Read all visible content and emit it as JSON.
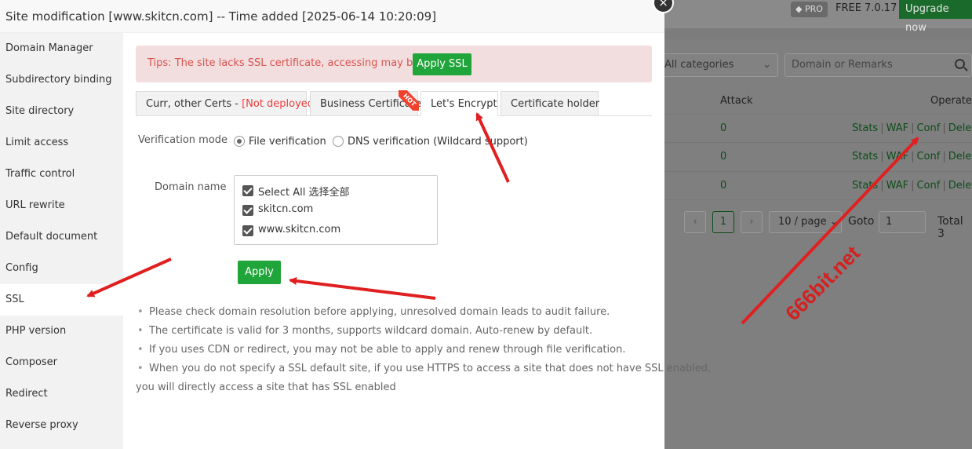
{
  "header_right": {
    "pro": "PRO",
    "free": "FREE",
    "version": "7.0.17",
    "upgrade": "Upgrade now"
  },
  "filters": {
    "category": "All categories",
    "search_placeholder": "Domain or Remarks"
  },
  "table": {
    "headers": {
      "attack": "Attack",
      "operate": "Operate"
    },
    "rows": [
      {
        "attack": "0",
        "actions": [
          "Stats",
          "WAF",
          "Conf",
          "Delete"
        ]
      },
      {
        "attack": "0",
        "actions": [
          "Stats",
          "WAF",
          "Conf",
          "Delete"
        ]
      },
      {
        "attack": "0",
        "actions": [
          "Stats",
          "WAF",
          "Conf",
          "Delete"
        ]
      }
    ]
  },
  "pagination": {
    "current_page": "1",
    "page_size": "10 / page",
    "goto_label": "Goto",
    "goto_value": "1",
    "total": "Total 3"
  },
  "modal": {
    "title": "Site modification [www.skitcn.com] -- Time added [2025-06-14 10:20:09]",
    "close": "×",
    "sidebar": [
      "Domain Manager",
      "Subdirectory binding",
      "Site directory",
      "Limit access",
      "Traffic control",
      "URL rewrite",
      "Default document",
      "Config",
      "SSL",
      "PHP version",
      "Composer",
      "Redirect",
      "Reverse proxy"
    ],
    "active_item": "SSL",
    "tips": {
      "text": "Tips: The site lacks SSL certificate, accessing may be risky.",
      "button": "Apply SSL"
    },
    "tabs": {
      "current_prefix": "Curr, other Certs - ",
      "current_status": "[Not deployed]",
      "business": "Business Certificate",
      "hot": "HOT",
      "letsencrypt": "Let's Encrypt",
      "holder": "Certificate holder"
    },
    "verification": {
      "label": "Verification mode",
      "file": "File verification",
      "dns": "DNS verification (Wildcard support)"
    },
    "domain_name": {
      "label": "Domain name",
      "select_all": "Select All  选择全部",
      "items": [
        "skitcn.com",
        "www.skitcn.com"
      ]
    },
    "apply_button": "Apply",
    "notes": [
      "Please check domain resolution before applying, unresolved domain leads to audit failure.",
      "The certificate is valid for 3 months, supports wildcard domain. Auto-renew by default.",
      "If you uses CDN or redirect, you may not be able to apply and renew through file verification.",
      "When you do not specify a SSL default site, if you use HTTPS to access a site that does not have SSL enabled,"
    ],
    "notes_cont": "you will directly access a site that has SSL enabled"
  },
  "watermark": "666bit.net",
  "colors": {
    "primary": "#20a53a",
    "tip_bg": "#f2dede",
    "tip_text": "#d9534f",
    "arrow": "#e02020"
  }
}
